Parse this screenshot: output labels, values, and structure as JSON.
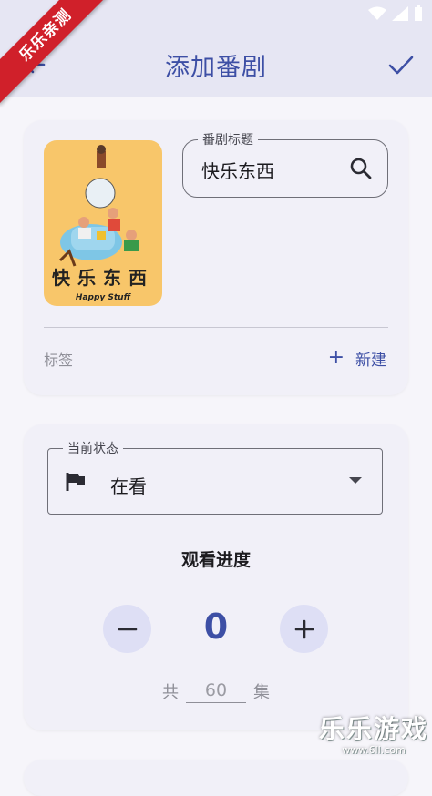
{
  "ribbon": {
    "text": "乐乐亲测"
  },
  "appbar": {
    "title": "添加番剧"
  },
  "anime": {
    "title_label": "番剧标题",
    "title_value": "快乐东西",
    "poster_title": "快乐东西",
    "poster_subtitle": "Happy Stuff"
  },
  "tags": {
    "label": "标签",
    "new_icon": "+",
    "new_label": "新建"
  },
  "status": {
    "label": "当前状态",
    "value": "在看"
  },
  "progress": {
    "label": "观看进度",
    "current": "0",
    "minus": "−",
    "plus": "+",
    "total_prefix": "共",
    "total_value": "60",
    "total_suffix": "集"
  },
  "watermark": {
    "main": "乐乐游戏",
    "url": "www.6ll.com"
  },
  "colors": {
    "accent": "#3d4fa5",
    "appbar": "#e6e6f3",
    "card": "#f1f0f8",
    "button_tint": "#dedff5",
    "ribbon": "#d0202a"
  },
  "icons": [
    "back-arrow-icon",
    "check-icon",
    "search-icon",
    "flag-icon",
    "dropdown-arrow-icon",
    "plus-icon",
    "minus-icon",
    "wifi-icon",
    "signal-icon",
    "battery-icon"
  ]
}
